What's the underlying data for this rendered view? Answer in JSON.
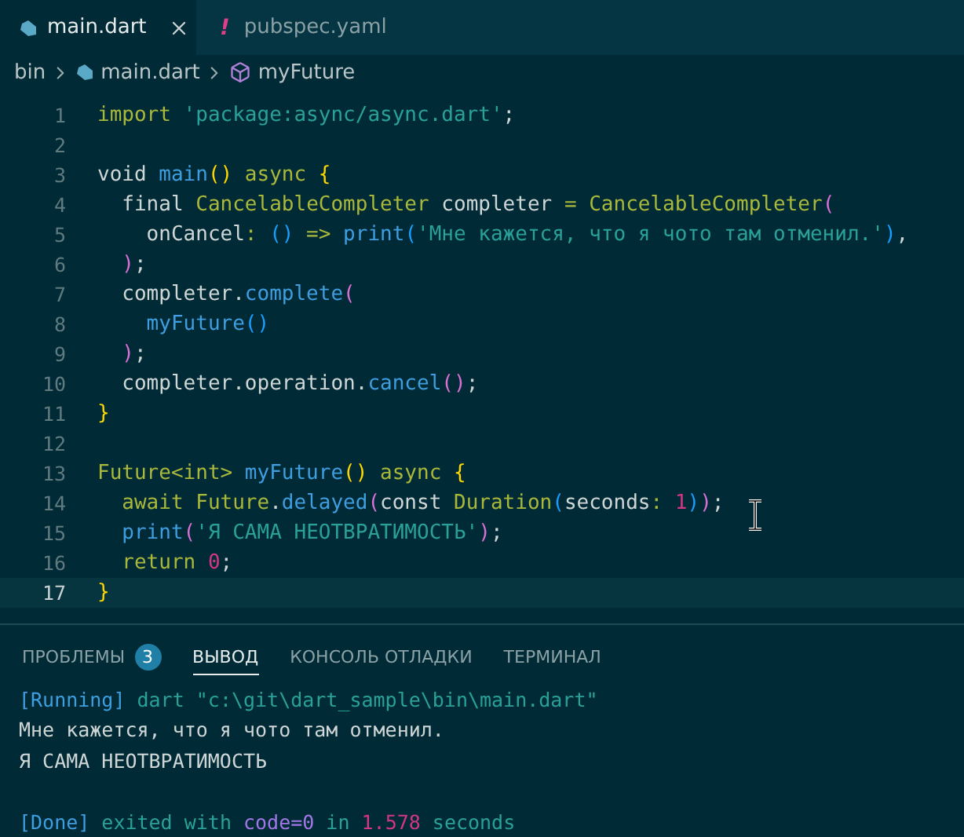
{
  "tabs": [
    {
      "label": "main.dart",
      "selected": true,
      "kind": "dart"
    },
    {
      "label": "pubspec.yaml",
      "selected": false,
      "kind": "yaml",
      "glyph": "!"
    }
  ],
  "breadcrumb": [
    {
      "label": "bin",
      "kind": "folder"
    },
    {
      "label": "main.dart",
      "kind": "dart"
    },
    {
      "label": "myFuture",
      "kind": "symbol"
    }
  ],
  "code": [
    {
      "number": "1",
      "current": false,
      "tokens": [
        {
          "text": "import",
          "kind": "kw"
        },
        {
          "text": " 'package:async/async.dart'",
          "kind": "str"
        },
        {
          "text": ";",
          "kind": "plain"
        }
      ]
    },
    {
      "number": "2",
      "current": false
    },
    {
      "number": "3",
      "current": false,
      "tokens": [
        {
          "text": "void ",
          "kind": "plain"
        },
        {
          "text": "main",
          "kind": "fn"
        },
        {
          "text": "()",
          "kind": "b1"
        },
        {
          "text": " async ",
          "kind": "kw"
        },
        {
          "text": "{",
          "kind": "b1"
        }
      ]
    },
    {
      "number": "4",
      "current": false,
      "tokens": [
        {
          "text": "  final ",
          "kind": "plain"
        },
        {
          "text": "CancelableCompleter",
          "kind": "kw"
        },
        {
          "text": " completer ",
          "kind": "plain"
        },
        {
          "text": "=",
          "kind": "kw"
        },
        {
          "text": " CancelableCompleter",
          "kind": "kw"
        },
        {
          "text": "(",
          "kind": "b2"
        }
      ]
    },
    {
      "number": "5",
      "current": false,
      "tokens": [
        {
          "text": "    onCancel",
          "kind": "plain"
        },
        {
          "text": ": ",
          "kind": "kw"
        },
        {
          "text": "()",
          "kind": "b3"
        },
        {
          "text": " => ",
          "kind": "kw"
        },
        {
          "text": "print",
          "kind": "fn"
        },
        {
          "text": "(",
          "kind": "b3"
        },
        {
          "text": "'Мне кажется, что я чото там отменил.'",
          "kind": "str"
        },
        {
          "text": ")",
          "kind": "b3"
        },
        {
          "text": ",",
          "kind": "plain"
        }
      ]
    },
    {
      "number": "6",
      "current": false,
      "tokens": [
        {
          "text": "  )",
          "kind": "b2"
        },
        {
          "text": ";",
          "kind": "plain"
        }
      ]
    },
    {
      "number": "7",
      "current": false,
      "tokens": [
        {
          "text": "  completer.",
          "kind": "plain"
        },
        {
          "text": "complete",
          "kind": "fn"
        },
        {
          "text": "(",
          "kind": "b2"
        }
      ]
    },
    {
      "number": "8",
      "current": false,
      "tokens": [
        {
          "text": "    myFuture",
          "kind": "fn"
        },
        {
          "text": "()",
          "kind": "b3"
        }
      ]
    },
    {
      "number": "9",
      "current": false,
      "tokens": [
        {
          "text": "  )",
          "kind": "b2"
        },
        {
          "text": ";",
          "kind": "plain"
        }
      ]
    },
    {
      "number": "10",
      "current": false,
      "tokens": [
        {
          "text": "  completer.operation.",
          "kind": "plain"
        },
        {
          "text": "cancel",
          "kind": "fn"
        },
        {
          "text": "()",
          "kind": "b2"
        },
        {
          "text": ";",
          "kind": "plain"
        }
      ]
    },
    {
      "number": "11",
      "current": false,
      "tokens": [
        {
          "text": "}",
          "kind": "b1"
        }
      ]
    },
    {
      "number": "12",
      "current": false
    },
    {
      "number": "13",
      "current": false,
      "tokens": [
        {
          "text": "Future<int> ",
          "kind": "kw"
        },
        {
          "text": "myFuture",
          "kind": "fn"
        },
        {
          "text": "()",
          "kind": "b1"
        },
        {
          "text": " async ",
          "kind": "kw"
        },
        {
          "text": "{",
          "kind": "b1"
        }
      ]
    },
    {
      "number": "14",
      "current": false,
      "tokens": [
        {
          "text": "  await Future",
          "kind": "kw"
        },
        {
          "text": ".",
          "kind": "plain"
        },
        {
          "text": "delayed",
          "kind": "fn"
        },
        {
          "text": "(",
          "kind": "b2"
        },
        {
          "text": "const ",
          "kind": "plain"
        },
        {
          "text": "Duration",
          "kind": "kw"
        },
        {
          "text": "(",
          "kind": "b3"
        },
        {
          "text": "seconds",
          "kind": "plain"
        },
        {
          "text": ": ",
          "kind": "kw"
        },
        {
          "text": "1",
          "kind": "num"
        },
        {
          "text": ")",
          "kind": "b3"
        },
        {
          "text": ")",
          "kind": "b2"
        },
        {
          "text": ";",
          "kind": "plain"
        }
      ]
    },
    {
      "number": "15",
      "current": false,
      "tokens": [
        {
          "text": "  print",
          "kind": "fn"
        },
        {
          "text": "(",
          "kind": "b2"
        },
        {
          "text": "'Я САМА НЕОТВРАТИМОСТЬ'",
          "kind": "str"
        },
        {
          "text": ")",
          "kind": "b2"
        },
        {
          "text": ";",
          "kind": "plain"
        }
      ]
    },
    {
      "number": "16",
      "current": false,
      "tokens": [
        {
          "text": "  return ",
          "kind": "kw"
        },
        {
          "text": "0",
          "kind": "num"
        },
        {
          "text": ";",
          "kind": "plain"
        }
      ]
    },
    {
      "number": "17",
      "current": true,
      "tokens": [
        {
          "text": "}",
          "kind": "b1"
        }
      ]
    }
  ],
  "panel": {
    "tabs": [
      {
        "label": "ПРОБЛЕМЫ",
        "badge": "3",
        "selected": false
      },
      {
        "label": "ВЫВОД",
        "selected": true
      },
      {
        "label": "КОНСОЛЬ ОТЛАДКИ",
        "selected": false
      },
      {
        "label": "ТЕРМИНАЛ",
        "selected": false
      }
    ],
    "output": [
      {
        "kind": "log",
        "tokens": [
          {
            "text": "[Running]",
            "kind": "fn"
          },
          {
            "text": " dart \"c:\\git\\dart_sample\\bin\\main.dart\"",
            "kind": "str"
          }
        ]
      },
      {
        "kind": "log",
        "tokens": [
          {
            "text": "Мне кажется, что я чото там отменил.",
            "kind": "out"
          }
        ]
      },
      {
        "kind": "log",
        "tokens": [
          {
            "text": "Я САМА НЕОТВРАТИМОСТЬ",
            "kind": "out"
          }
        ]
      },
      {
        "kind": "status",
        "tokens": [
          {
            "text": "[Done]",
            "kind": "fn"
          },
          {
            "text": " exited with ",
            "kind": "str"
          },
          {
            "text": "code=0",
            "kind": "code"
          },
          {
            "text": " in ",
            "kind": "str"
          },
          {
            "text": "1.578",
            "kind": "num"
          },
          {
            "text": " seconds",
            "kind": "str"
          }
        ]
      }
    ]
  }
}
